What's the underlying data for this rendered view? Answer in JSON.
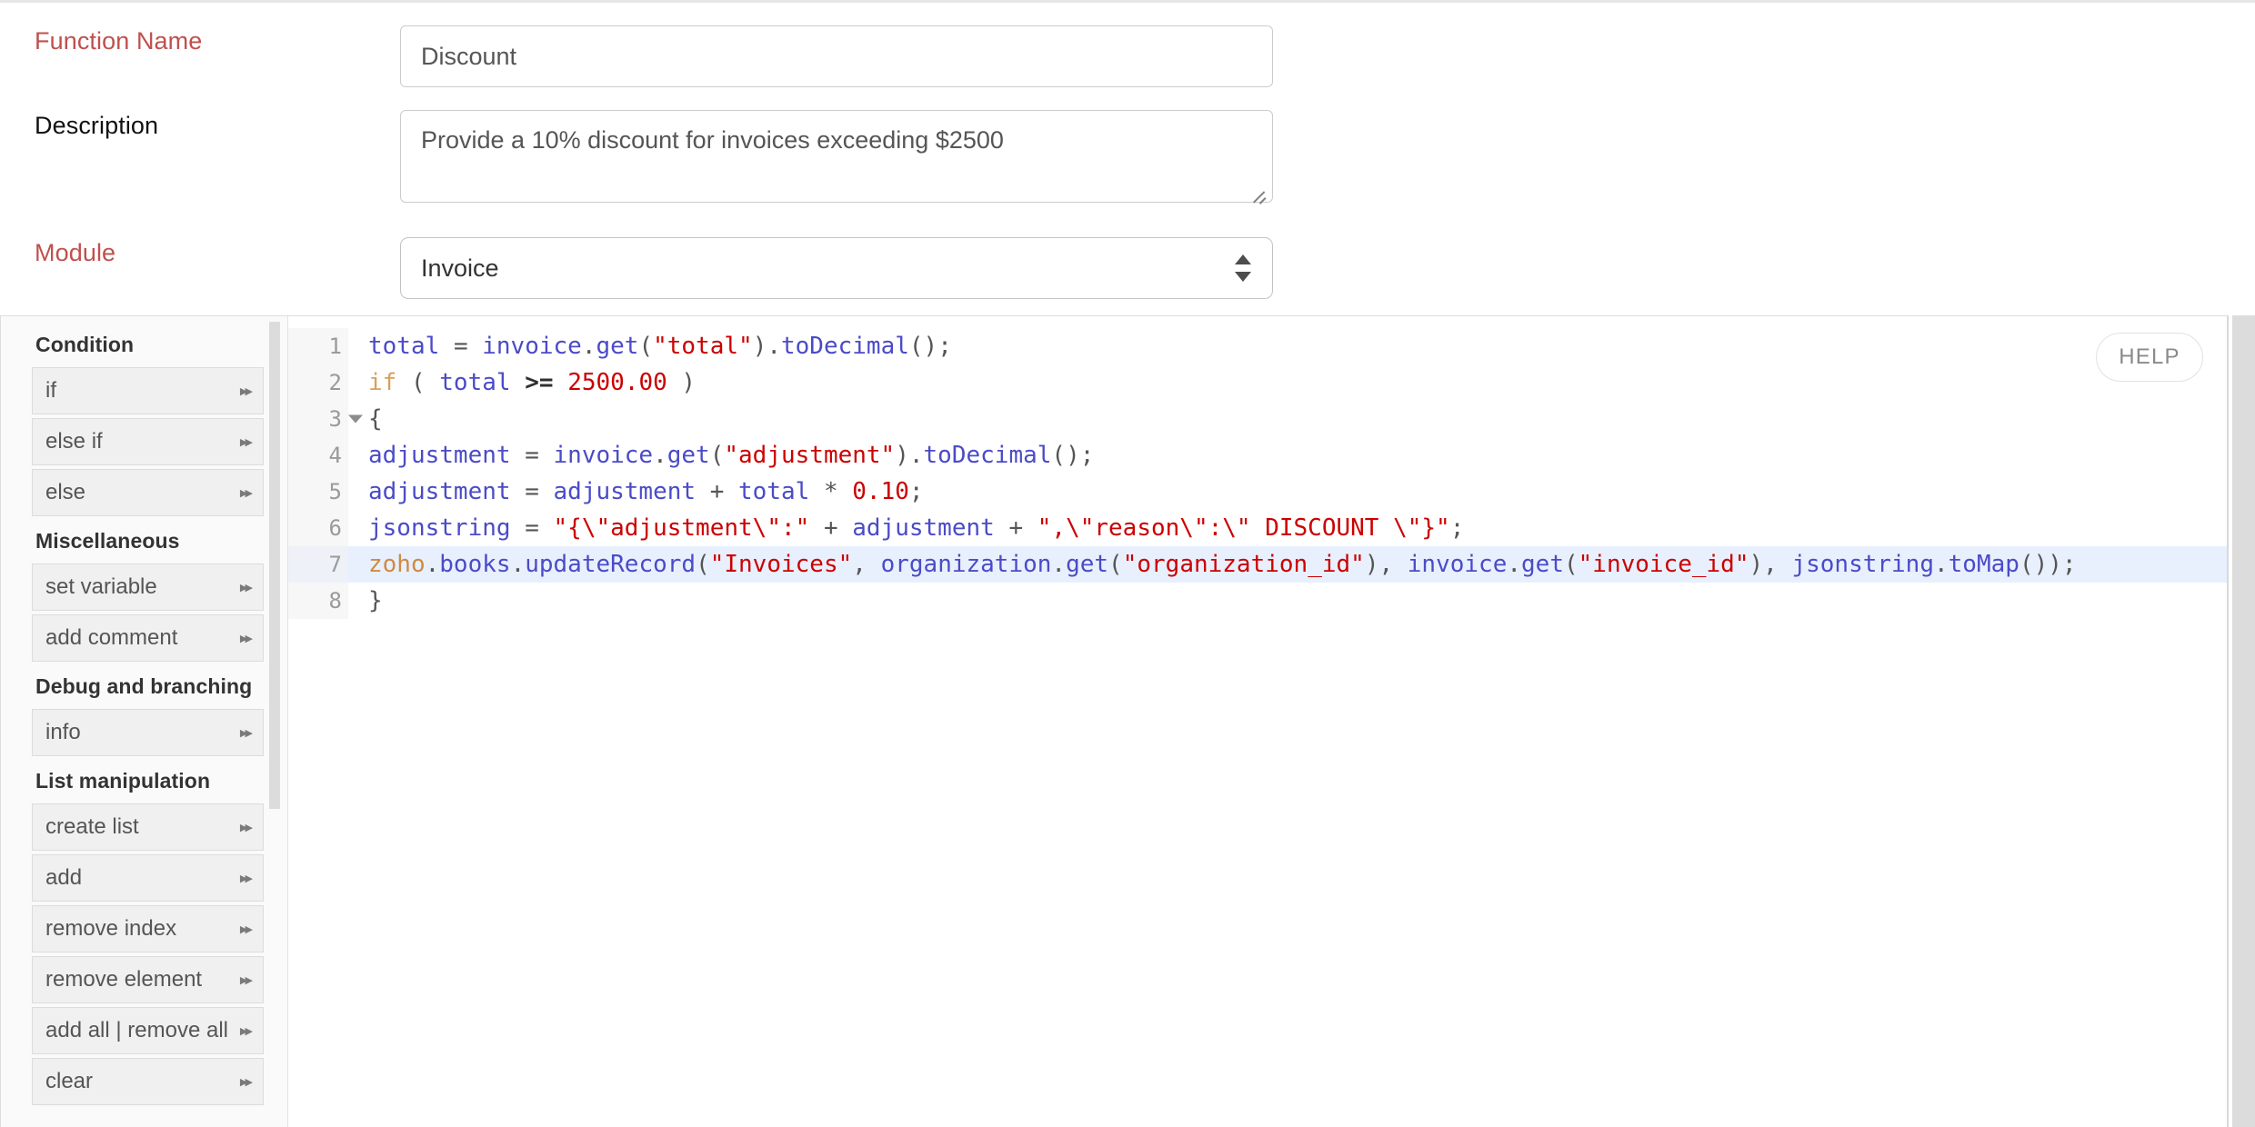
{
  "form": {
    "function_name": {
      "label": "Function Name",
      "value": "Discount",
      "required": true
    },
    "description": {
      "label": "Description",
      "value": "Provide a 10% discount for invoices exceeding $2500",
      "required": false
    },
    "module": {
      "label": "Module",
      "value": "Invoice",
      "required": true,
      "options": [
        "Invoice"
      ]
    }
  },
  "colors": {
    "required_label": "#c0504d",
    "label": "#111111",
    "input_border": "#cccccc",
    "sidebar_bg": "#fafafa",
    "snippet_bg": "#f0f0f0",
    "highlight_line": "#e8f0fe",
    "gutter_bg": "#f7f7f7",
    "string_token": "#cc0000",
    "variable_token": "#4b4bc8",
    "keyword_token": "#d9a05b",
    "namespace_token": "#d08a41"
  },
  "sidebar": {
    "groups": [
      {
        "title": "Condition",
        "items": [
          {
            "label": "if",
            "arrow": "double-chevron-right-icon"
          },
          {
            "label": "else if",
            "arrow": "double-chevron-right-icon"
          },
          {
            "label": "else",
            "arrow": "double-chevron-right-icon"
          }
        ]
      },
      {
        "title": "Miscellaneous",
        "items": [
          {
            "label": "set variable",
            "arrow": "double-chevron-right-icon"
          },
          {
            "label": "add comment",
            "arrow": "double-chevron-right-icon"
          }
        ]
      },
      {
        "title": "Debug and branching",
        "items": [
          {
            "label": "info",
            "arrow": "double-chevron-right-icon"
          }
        ]
      },
      {
        "title": "List manipulation",
        "items": [
          {
            "label": "create list",
            "arrow": "double-chevron-right-icon"
          },
          {
            "label": "add",
            "arrow": "double-chevron-right-icon"
          },
          {
            "label": "remove index",
            "arrow": "double-chevron-right-icon"
          },
          {
            "label": "remove element",
            "arrow": "double-chevron-right-icon"
          },
          {
            "label": "add all | remove all",
            "arrow": "double-chevron-right-icon"
          },
          {
            "label": "clear",
            "arrow": "double-chevron-right-icon"
          }
        ]
      }
    ],
    "arrow_glyph": "▸▸"
  },
  "editor": {
    "help_label": "HELP",
    "fold_line": 3,
    "highlighted_line": 7,
    "lines": [
      {
        "n": "1",
        "text": "total = invoice.get(\"total\").toDecimal();"
      },
      {
        "n": "2",
        "text": "if ( total >= 2500.00 )"
      },
      {
        "n": "3",
        "text": "{"
      },
      {
        "n": "4",
        "text": "adjustment = invoice.get(\"adjustment\").toDecimal();"
      },
      {
        "n": "5",
        "text": "adjustment = adjustment + total * 0.10;"
      },
      {
        "n": "6",
        "text": "jsonstring = \"{\\\"adjustment\\\":\" + adjustment + \",\\\"reason\\\":\\\" DISCOUNT \\\"}\";"
      },
      {
        "n": "7",
        "text": "zoho.books.updateRecord(\"Invoices\", organization.get(\"organization_id\"), invoice.get(\"invoice_id\"), jsonstring.toMap());"
      },
      {
        "n": "8",
        "text": "}"
      }
    ]
  }
}
